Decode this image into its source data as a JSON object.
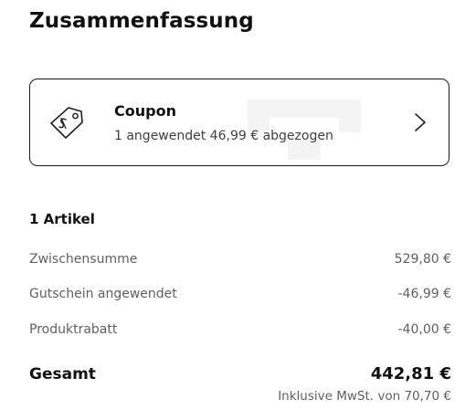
{
  "page": {
    "title": "Zusammenfassung"
  },
  "coupon": {
    "title": "Coupon",
    "subtitle": "1 angewendet 46,99 € abgezogen",
    "icon": "tag-icon"
  },
  "summary": {
    "items_heading": "1 Artikel",
    "lines": [
      {
        "label": "Zwischensumme",
        "value": "529,80 €"
      },
      {
        "label": "Gutschein angewendet",
        "value": "-46,99 €"
      },
      {
        "label": "Produktrabatt",
        "value": "-40,00 €"
      }
    ],
    "total_label": "Gesamt",
    "total_value": "442,81 €",
    "vat_note": "Inklusive MwSt. von 70,70 €"
  },
  "colors": {
    "text_primary": "#111111",
    "text_secondary": "#5f5f5f",
    "border": "#1a1a1a",
    "background": "#ffffff"
  }
}
